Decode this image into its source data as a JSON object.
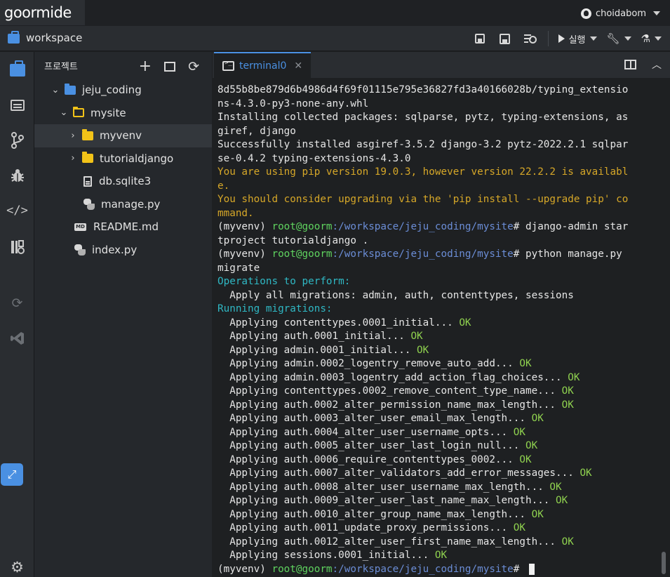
{
  "app": {
    "logo": "goormide",
    "user": "choidabom"
  },
  "toolbar": {
    "workspace": "workspace",
    "run_label": "실행"
  },
  "sidebar": {
    "header": "프로젝트",
    "tree": [
      {
        "name": "jeju_coding",
        "kind": "folder-root",
        "depth": 0,
        "expanded": true
      },
      {
        "name": "mysite",
        "kind": "folder",
        "depth": 1,
        "expanded": true
      },
      {
        "name": "myvenv",
        "kind": "folder",
        "depth": 2,
        "expanded": false,
        "selected": true
      },
      {
        "name": "tutorialdjango",
        "kind": "folder",
        "depth": 2,
        "expanded": false
      },
      {
        "name": "db.sqlite3",
        "kind": "file",
        "depth": 2
      },
      {
        "name": "manage.py",
        "kind": "python",
        "depth": 2
      },
      {
        "name": "README.md",
        "kind": "markdown",
        "depth": 1
      },
      {
        "name": "index.py",
        "kind": "python",
        "depth": 1
      }
    ]
  },
  "terminal": {
    "tab_label": "terminal0",
    "prompt": {
      "env": "(myvenv) ",
      "user": "root@goorm",
      "path": ":/workspace/jeju_coding/mysite",
      "symbol": "# "
    },
    "lines": [
      {
        "parts": [
          {
            "t": "8d55b8be879d6b4986d4f69f01115e795e36827fd3a40166028b/typing_extensio",
            "c": ""
          }
        ]
      },
      {
        "parts": [
          {
            "t": "ns-4.3.0-py3-none-any.whl",
            "c": ""
          }
        ]
      },
      {
        "parts": [
          {
            "t": "Installing collected packages: sqlparse, pytz, typing-extensions, as",
            "c": ""
          }
        ]
      },
      {
        "parts": [
          {
            "t": "giref, django",
            "c": ""
          }
        ]
      },
      {
        "parts": [
          {
            "t": "Successfully installed asgiref-3.5.2 django-3.2 pytz-2022.2.1 sqlpar",
            "c": ""
          }
        ]
      },
      {
        "parts": [
          {
            "t": "se-0.4.2 typing-extensions-4.3.0",
            "c": ""
          }
        ]
      },
      {
        "parts": [
          {
            "t": "You are using pip version 19.0.3, however version 22.2.2 is availabl",
            "c": "c-warn"
          }
        ]
      },
      {
        "parts": [
          {
            "t": "e.",
            "c": "c-warn"
          }
        ]
      },
      {
        "parts": [
          {
            "t": "You should consider upgrading via the 'pip install --upgrade pip' co",
            "c": "c-warn"
          }
        ]
      },
      {
        "parts": [
          {
            "t": "mmand.",
            "c": "c-warn"
          }
        ]
      },
      {
        "parts": [
          {
            "t": "(myvenv) ",
            "c": ""
          },
          {
            "t": "root@goorm",
            "c": "c-green"
          },
          {
            "t": ":/workspace/jeju_coding/mysite",
            "c": "c-path"
          },
          {
            "t": "# django-admin star",
            "c": ""
          }
        ]
      },
      {
        "parts": [
          {
            "t": "tproject tutorialdjango .",
            "c": ""
          }
        ]
      },
      {
        "parts": [
          {
            "t": "(myvenv) ",
            "c": ""
          },
          {
            "t": "root@goorm",
            "c": "c-green"
          },
          {
            "t": ":/workspace/jeju_coding/mysite",
            "c": "c-path"
          },
          {
            "t": "# python manage.py",
            "c": ""
          }
        ]
      },
      {
        "parts": [
          {
            "t": "migrate",
            "c": ""
          }
        ]
      },
      {
        "parts": [
          {
            "t": "Operations to perform:",
            "c": "c-cyan"
          }
        ]
      },
      {
        "parts": [
          {
            "t": "  Apply all migrations: admin, auth, contenttypes, sessions",
            "c": ""
          }
        ]
      },
      {
        "parts": [
          {
            "t": "Running migrations:",
            "c": "c-cyan"
          }
        ]
      },
      {
        "parts": [
          {
            "t": "  Applying contenttypes.0001_initial... ",
            "c": ""
          },
          {
            "t": "OK",
            "c": "c-ok"
          }
        ]
      },
      {
        "parts": [
          {
            "t": "  Applying auth.0001_initial... ",
            "c": ""
          },
          {
            "t": "OK",
            "c": "c-ok"
          }
        ]
      },
      {
        "parts": [
          {
            "t": "  Applying admin.0001_initial... ",
            "c": ""
          },
          {
            "t": "OK",
            "c": "c-ok"
          }
        ]
      },
      {
        "parts": [
          {
            "t": "  Applying admin.0002_logentry_remove_auto_add... ",
            "c": ""
          },
          {
            "t": "OK",
            "c": "c-ok"
          }
        ]
      },
      {
        "parts": [
          {
            "t": "  Applying admin.0003_logentry_add_action_flag_choices... ",
            "c": ""
          },
          {
            "t": "OK",
            "c": "c-ok"
          }
        ]
      },
      {
        "parts": [
          {
            "t": "  Applying contenttypes.0002_remove_content_type_name... ",
            "c": ""
          },
          {
            "t": "OK",
            "c": "c-ok"
          }
        ]
      },
      {
        "parts": [
          {
            "t": "  Applying auth.0002_alter_permission_name_max_length... ",
            "c": ""
          },
          {
            "t": "OK",
            "c": "c-ok"
          }
        ]
      },
      {
        "parts": [
          {
            "t": "  Applying auth.0003_alter_user_email_max_length... ",
            "c": ""
          },
          {
            "t": "OK",
            "c": "c-ok"
          }
        ]
      },
      {
        "parts": [
          {
            "t": "  Applying auth.0004_alter_user_username_opts... ",
            "c": ""
          },
          {
            "t": "OK",
            "c": "c-ok"
          }
        ]
      },
      {
        "parts": [
          {
            "t": "  Applying auth.0005_alter_user_last_login_null... ",
            "c": ""
          },
          {
            "t": "OK",
            "c": "c-ok"
          }
        ]
      },
      {
        "parts": [
          {
            "t": "  Applying auth.0006_require_contenttypes_0002... ",
            "c": ""
          },
          {
            "t": "OK",
            "c": "c-ok"
          }
        ]
      },
      {
        "parts": [
          {
            "t": "  Applying auth.0007_alter_validators_add_error_messages... ",
            "c": ""
          },
          {
            "t": "OK",
            "c": "c-ok"
          }
        ]
      },
      {
        "parts": [
          {
            "t": "  Applying auth.0008_alter_user_username_max_length... ",
            "c": ""
          },
          {
            "t": "OK",
            "c": "c-ok"
          }
        ]
      },
      {
        "parts": [
          {
            "t": "  Applying auth.0009_alter_user_last_name_max_length... ",
            "c": ""
          },
          {
            "t": "OK",
            "c": "c-ok"
          }
        ]
      },
      {
        "parts": [
          {
            "t": "  Applying auth.0010_alter_group_name_max_length... ",
            "c": ""
          },
          {
            "t": "OK",
            "c": "c-ok"
          }
        ]
      },
      {
        "parts": [
          {
            "t": "  Applying auth.0011_update_proxy_permissions... ",
            "c": ""
          },
          {
            "t": "OK",
            "c": "c-ok"
          }
        ]
      },
      {
        "parts": [
          {
            "t": "  Applying auth.0012_alter_user_first_name_max_length... ",
            "c": ""
          },
          {
            "t": "OK",
            "c": "c-ok"
          }
        ]
      },
      {
        "parts": [
          {
            "t": "  Applying sessions.0001_initial... ",
            "c": ""
          },
          {
            "t": "OK",
            "c": "c-ok"
          }
        ]
      },
      {
        "parts": [
          {
            "t": "(myvenv) ",
            "c": ""
          },
          {
            "t": "root@goorm",
            "c": "c-green"
          },
          {
            "t": ":/workspace/jeju_coding/mysite",
            "c": "c-path"
          },
          {
            "t": "# ",
            "c": ""
          }
        ],
        "cursor": true
      }
    ]
  },
  "colors": {
    "accent": "#4a90e2",
    "warning": "#d6a728",
    "ok": "#8fd14f",
    "prompt_user": "#5fd35f",
    "prompt_path": "#6b8dd6",
    "heading": "#2fb8c4"
  },
  "icons": {
    "activity": [
      "project-icon",
      "outline-icon",
      "git-icon",
      "debug-icon",
      "code-icon",
      "container-icon",
      "sync-icon",
      "vscode-icon",
      "expand-icon",
      "settings-icon"
    ]
  }
}
